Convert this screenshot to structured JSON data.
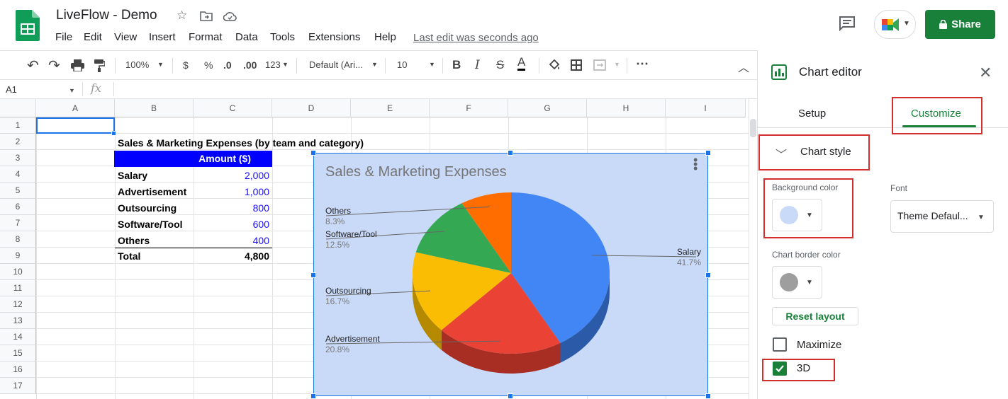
{
  "title_bar": {
    "doc_title": "LiveFlow - Demo",
    "menu": [
      "File",
      "Edit",
      "View",
      "Insert",
      "Format",
      "Data",
      "Tools",
      "Extensions",
      "Help"
    ],
    "last_edit": "Last edit was seconds ago",
    "share_label": "Share"
  },
  "toolbar": {
    "zoom": "100%",
    "currency": "$",
    "percent": "%",
    "decimal_decrease": ".0",
    "decimal_increase": ".00",
    "number_format": "123",
    "font": "Default (Ari...",
    "font_size": "10",
    "bold": "B",
    "italic": "I",
    "strike": "S",
    "text_color": "A",
    "more": "⋯"
  },
  "formula_bar": {
    "name_box": "A1",
    "fx": "fx"
  },
  "grid": {
    "columns": [
      "A",
      "B",
      "C",
      "D",
      "E",
      "F",
      "G",
      "H",
      "I"
    ],
    "rows": [
      "1",
      "2",
      "3",
      "4",
      "5",
      "6",
      "7",
      "8",
      "9",
      "10",
      "11",
      "12",
      "13",
      "14",
      "15",
      "16",
      "17"
    ]
  },
  "table": {
    "heading": "Sales & Marketing Expenses (by team and category)",
    "amount_header": "Amount ($)",
    "rows": [
      {
        "label": "Salary",
        "value": "2,000"
      },
      {
        "label": "Advertisement",
        "value": "1,000"
      },
      {
        "label": "Outsourcing",
        "value": "800"
      },
      {
        "label": "Software/Tool",
        "value": "600"
      },
      {
        "label": "Others",
        "value": "400"
      }
    ],
    "total_label": "Total",
    "total_value": "4,800"
  },
  "chart_data": {
    "type": "pie",
    "title": "Sales & Marketing Expenses",
    "is_3d": true,
    "background_color": "#c9daf8",
    "categories": [
      "Salary",
      "Advertisement",
      "Outsourcing",
      "Software/Tool",
      "Others"
    ],
    "values": [
      2000,
      1000,
      800,
      600,
      400
    ],
    "percent_labels": [
      "41.7%",
      "20.8%",
      "16.7%",
      "12.5%",
      "8.3%"
    ],
    "colors": [
      "#4285f4",
      "#ea4335",
      "#fbbc04",
      "#34a853",
      "#ff6d01"
    ],
    "side_colors": [
      "#2a5aa8",
      "#a82e24",
      "#b58a00",
      "#23753a",
      "#b54d00"
    ]
  },
  "editor": {
    "title": "Chart editor",
    "close": "✕",
    "tabs": [
      "Setup",
      "Customize"
    ],
    "section": "Chart style",
    "background_color_label": "Background color",
    "background_swatch": "#c9daf8",
    "font_label": "Font",
    "font_value": "Theme Defaul...",
    "border_color_label": "Chart border color",
    "border_swatch": "#9e9e9e",
    "reset_label": "Reset layout",
    "maximize_label": "Maximize",
    "threed_label": "3D",
    "accent": "#188038",
    "highlight": "#d32f2f"
  }
}
